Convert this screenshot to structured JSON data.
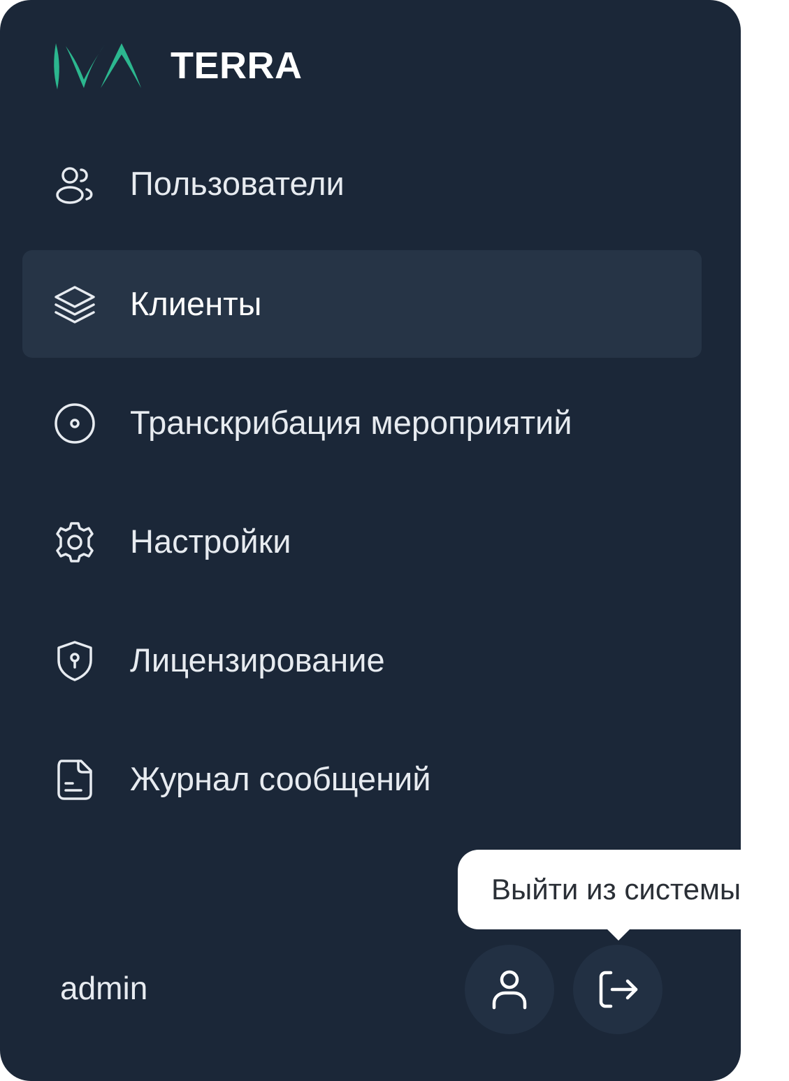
{
  "brand": {
    "name": "TERRA",
    "logo_color": "#2cb78f"
  },
  "sidebar": {
    "items": [
      {
        "label": "Пользователи",
        "icon": "users-icon",
        "active": false
      },
      {
        "label": "Клиенты",
        "icon": "layers-icon",
        "active": true
      },
      {
        "label": "Транскрибация мероприятий",
        "icon": "record-icon",
        "active": false
      },
      {
        "label": "Настройки",
        "icon": "gear-icon",
        "active": false
      },
      {
        "label": "Лицензирование",
        "icon": "shield-key-icon",
        "active": false
      },
      {
        "label": "Журнал сообщений",
        "icon": "document-icon",
        "active": false
      }
    ]
  },
  "footer": {
    "username": "admin",
    "profile_icon": "user-icon",
    "logout_icon": "logout-icon",
    "logout_tooltip": "Выйти из системы"
  },
  "colors": {
    "background": "#1b2738",
    "active_item": "#263446",
    "button_bg": "#223043",
    "text": "#e7ebf0"
  }
}
